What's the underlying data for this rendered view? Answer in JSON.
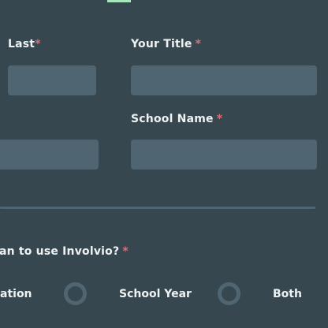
{
  "colors": {
    "background": "#37474f",
    "input": "#4f6672",
    "required": "#d9707a",
    "active_tab": "#a8e6c0"
  },
  "form": {
    "last_label": "Last",
    "title_label": "Your Title",
    "school_label": "School Name",
    "required_mark": "*",
    "question_label": "an to use Involvio?",
    "options": [
      "ation",
      "School Year",
      "Both"
    ]
  }
}
